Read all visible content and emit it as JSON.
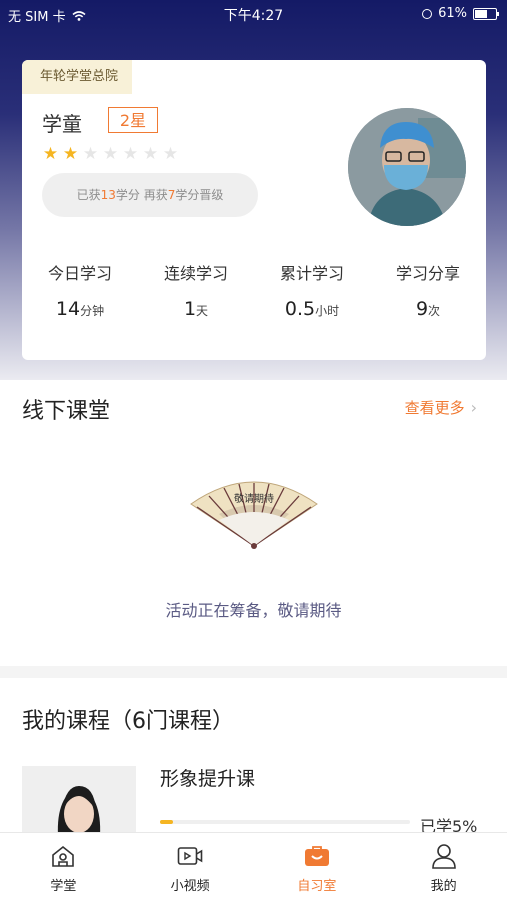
{
  "status_bar": {
    "carrier": "无 SIM 卡",
    "time": "下午4:27",
    "battery": "61%"
  },
  "profile": {
    "org_tag": "年轮学堂总院",
    "rank": "学童",
    "star_badge": "2星",
    "stars": {
      "filled": 2,
      "total": 7
    },
    "credit": {
      "t1": "已获",
      "earned": "13",
      "t2": "学分 再获",
      "needed": "7",
      "t3": "学分晋级"
    },
    "stats": [
      {
        "label": "今日学习",
        "value": "14",
        "unit": "分钟"
      },
      {
        "label": "连续学习",
        "value": "1",
        "unit": "天"
      },
      {
        "label": "累计学习",
        "value": "0.5",
        "unit": "小时"
      },
      {
        "label": "学习分享",
        "value": "9",
        "unit": "次"
      }
    ]
  },
  "offline": {
    "title": "线下课堂",
    "more": "查看更多",
    "fan_text": "敬请期待",
    "empty": "活动正在筹备，敬请期待"
  },
  "courses": {
    "title": "我的课程（6门课程）",
    "items": [
      {
        "name": "形象提升课",
        "progress": 5,
        "progress_text": "已学5%"
      }
    ]
  },
  "tabbar": [
    {
      "label": "学堂",
      "icon": "school-icon"
    },
    {
      "label": "小视频",
      "icon": "video-icon"
    },
    {
      "label": "自习室",
      "icon": "study-room-icon",
      "active": true
    },
    {
      "label": "我的",
      "icon": "user-icon"
    }
  ],
  "colors": {
    "accent": "#f07a33",
    "star": "#f5b522",
    "header_top": "#141a66"
  }
}
